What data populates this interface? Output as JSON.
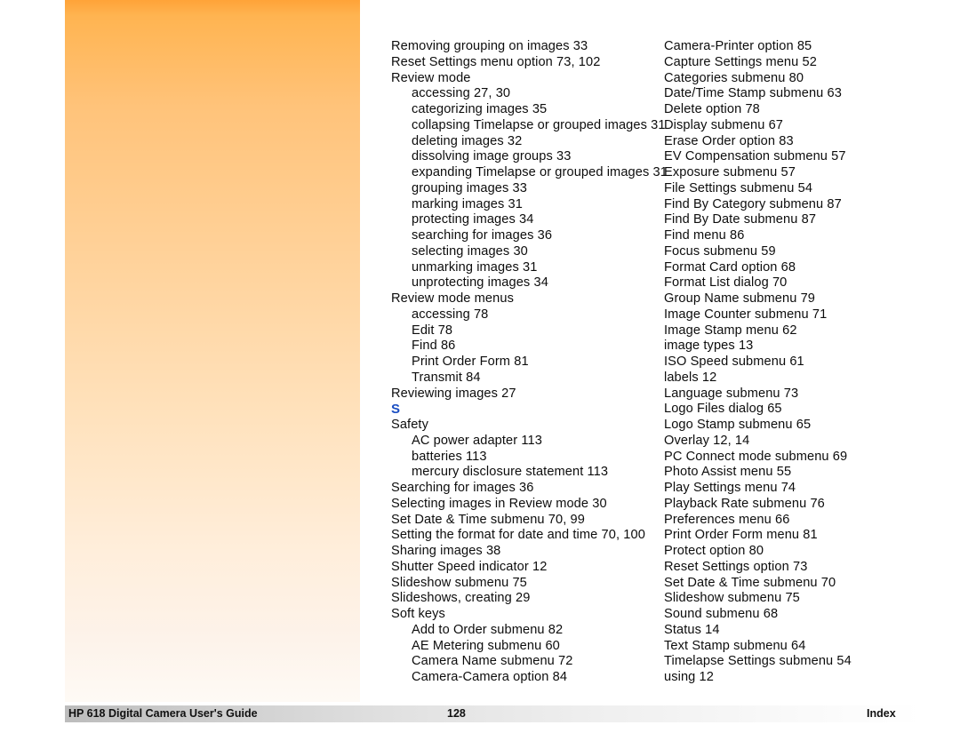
{
  "page": {
    "document_title": "HP 618 Digital Camera User's Guide",
    "page_number": "128",
    "section_label": "Index",
    "letter_heading_color": "#1a4ec3",
    "accent_panel_color": "#ffa338"
  },
  "index": {
    "columns": [
      {
        "name": "left-column",
        "entries": [
          {
            "text": "Removing grouping on images 33",
            "level": 1
          },
          {
            "text": "Reset Settings menu option 73, 102",
            "level": 1
          },
          {
            "text": "Review mode",
            "level": 1
          },
          {
            "text": "accessing 27, 30",
            "level": 2
          },
          {
            "text": "categorizing images 35",
            "level": 2
          },
          {
            "text": "collapsing Timelapse or grouped images 31",
            "level": 2
          },
          {
            "text": "deleting images 32",
            "level": 2
          },
          {
            "text": "dissolving image groups 33",
            "level": 2
          },
          {
            "text": "expanding Timelapse or grouped images 31",
            "level": 2
          },
          {
            "text": "grouping images 33",
            "level": 2
          },
          {
            "text": "marking images 31",
            "level": 2
          },
          {
            "text": "protecting images 34",
            "level": 2
          },
          {
            "text": "searching for images 36",
            "level": 2
          },
          {
            "text": "selecting images 30",
            "level": 2
          },
          {
            "text": "unmarking images 31",
            "level": 2
          },
          {
            "text": "unprotecting images 34",
            "level": 2
          },
          {
            "text": "Review mode menus",
            "level": 1
          },
          {
            "text": "accessing 78",
            "level": 2
          },
          {
            "text": "Edit 78",
            "level": 2
          },
          {
            "text": "Find 86",
            "level": 2
          },
          {
            "text": "Print Order Form 81",
            "level": 2
          },
          {
            "text": "Transmit 84",
            "level": 2
          },
          {
            "text": "Reviewing images 27",
            "level": 1
          },
          {
            "text": "S",
            "level": 0
          },
          {
            "text": "Safety",
            "level": 1
          },
          {
            "text": "AC power adapter 113",
            "level": 2
          },
          {
            "text": "batteries 113",
            "level": 2
          },
          {
            "text": "mercury disclosure statement 113",
            "level": 2
          },
          {
            "text": "Searching for images 36",
            "level": 1
          },
          {
            "text": "Selecting images in Review mode 30",
            "level": 1
          },
          {
            "text": "Set Date & Time submenu 70, 99",
            "level": 1
          },
          {
            "text": "Setting the format for date and time 70, 100",
            "level": 1
          },
          {
            "text": "Sharing images 38",
            "level": 1
          },
          {
            "text": "Shutter Speed indicator 12",
            "level": 1
          },
          {
            "text": "Slideshow submenu 75",
            "level": 1
          },
          {
            "text": "Slideshows, creating 29",
            "level": 1
          },
          {
            "text": "Soft keys",
            "level": 1
          },
          {
            "text": "Add to Order submenu 82",
            "level": 2
          },
          {
            "text": "AE Metering submenu 60",
            "level": 2
          },
          {
            "text": "Camera Name submenu 72",
            "level": 2
          },
          {
            "text": "Camera-Camera option 84",
            "level": 2
          }
        ]
      },
      {
        "name": "right-column",
        "entries": [
          {
            "text": "Camera-Printer option 85",
            "level": 1
          },
          {
            "text": "Capture Settings menu 52",
            "level": 1
          },
          {
            "text": "Categories submenu 80",
            "level": 1
          },
          {
            "text": "Date/Time Stamp submenu 63",
            "level": 1
          },
          {
            "text": "Delete option 78",
            "level": 1
          },
          {
            "text": "Display submenu 67",
            "level": 1
          },
          {
            "text": "Erase Order option 83",
            "level": 1
          },
          {
            "text": "EV Compensation submenu 57",
            "level": 1
          },
          {
            "text": "Exposure submenu 57",
            "level": 1
          },
          {
            "text": "File Settings submenu 54",
            "level": 1
          },
          {
            "text": "Find By Category submenu 87",
            "level": 1
          },
          {
            "text": "Find By Date submenu 87",
            "level": 1
          },
          {
            "text": "Find menu 86",
            "level": 1
          },
          {
            "text": "Focus submenu 59",
            "level": 1
          },
          {
            "text": "Format Card option 68",
            "level": 1
          },
          {
            "text": "Format List dialog 70",
            "level": 1
          },
          {
            "text": "Group Name submenu 79",
            "level": 1
          },
          {
            "text": "Image Counter submenu 71",
            "level": 1
          },
          {
            "text": "Image Stamp menu 62",
            "level": 1
          },
          {
            "text": "image types 13",
            "level": 1
          },
          {
            "text": "ISO Speed submenu 61",
            "level": 1
          },
          {
            "text": "labels 12",
            "level": 1
          },
          {
            "text": "Language submenu 73",
            "level": 1
          },
          {
            "text": "Logo Files dialog 65",
            "level": 1
          },
          {
            "text": "Logo Stamp submenu 65",
            "level": 1
          },
          {
            "text": "Overlay 12, 14",
            "level": 1
          },
          {
            "text": "PC Connect mode submenu 69",
            "level": 1
          },
          {
            "text": "Photo Assist menu 55",
            "level": 1
          },
          {
            "text": "Play Settings menu 74",
            "level": 1
          },
          {
            "text": "Playback Rate submenu 76",
            "level": 1
          },
          {
            "text": "Preferences menu 66",
            "level": 1
          },
          {
            "text": "Print Order Form menu 81",
            "level": 1
          },
          {
            "text": "Protect option 80",
            "level": 1
          },
          {
            "text": "Reset Settings option 73",
            "level": 1
          },
          {
            "text": "Set Date & Time submenu 70",
            "level": 1
          },
          {
            "text": "Slideshow submenu 75",
            "level": 1
          },
          {
            "text": "Sound submenu 68",
            "level": 1
          },
          {
            "text": "Status 14",
            "level": 1
          },
          {
            "text": "Text Stamp submenu 64",
            "level": 1
          },
          {
            "text": "Timelapse Settings submenu 54",
            "level": 1
          },
          {
            "text": "using 12",
            "level": 1
          }
        ]
      }
    ]
  }
}
